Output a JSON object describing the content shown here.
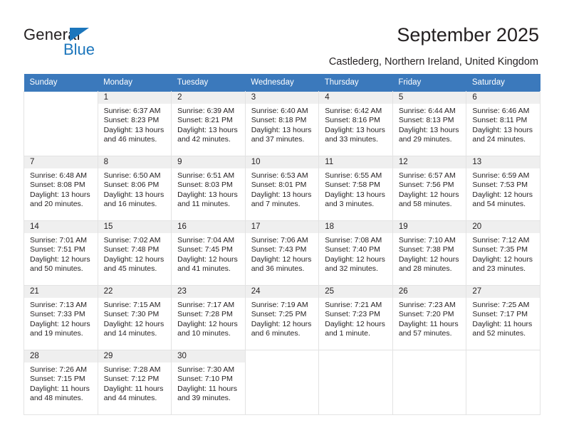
{
  "logo": {
    "word_one": "General",
    "word_two": "Blue",
    "triangle_icon": "blue-triangle-icon",
    "brand_color": "#1c76bc"
  },
  "header": {
    "title": "September 2025",
    "subtitle": "Castlederg, Northern Ireland, United Kingdom"
  },
  "theme": {
    "header_blue": "#3b79bc",
    "daynum_band": "#efefef",
    "grid_border": "#e3e3e3",
    "text": "#231f20"
  },
  "calendar": {
    "weekday_headers": [
      "Sunday",
      "Monday",
      "Tuesday",
      "Wednesday",
      "Thursday",
      "Friday",
      "Saturday"
    ],
    "weeks": [
      [
        {
          "day": "",
          "blank": true,
          "lines": []
        },
        {
          "day": "1",
          "lines": [
            "Sunrise: 6:37 AM",
            "Sunset: 8:23 PM",
            "Daylight: 13 hours",
            "and 46 minutes."
          ]
        },
        {
          "day": "2",
          "lines": [
            "Sunrise: 6:39 AM",
            "Sunset: 8:21 PM",
            "Daylight: 13 hours",
            "and 42 minutes."
          ]
        },
        {
          "day": "3",
          "lines": [
            "Sunrise: 6:40 AM",
            "Sunset: 8:18 PM",
            "Daylight: 13 hours",
            "and 37 minutes."
          ]
        },
        {
          "day": "4",
          "lines": [
            "Sunrise: 6:42 AM",
            "Sunset: 8:16 PM",
            "Daylight: 13 hours",
            "and 33 minutes."
          ]
        },
        {
          "day": "5",
          "lines": [
            "Sunrise: 6:44 AM",
            "Sunset: 8:13 PM",
            "Daylight: 13 hours",
            "and 29 minutes."
          ]
        },
        {
          "day": "6",
          "lines": [
            "Sunrise: 6:46 AM",
            "Sunset: 8:11 PM",
            "Daylight: 13 hours",
            "and 24 minutes."
          ]
        }
      ],
      [
        {
          "day": "7",
          "lines": [
            "Sunrise: 6:48 AM",
            "Sunset: 8:08 PM",
            "Daylight: 13 hours",
            "and 20 minutes."
          ]
        },
        {
          "day": "8",
          "lines": [
            "Sunrise: 6:50 AM",
            "Sunset: 8:06 PM",
            "Daylight: 13 hours",
            "and 16 minutes."
          ]
        },
        {
          "day": "9",
          "lines": [
            "Sunrise: 6:51 AM",
            "Sunset: 8:03 PM",
            "Daylight: 13 hours",
            "and 11 minutes."
          ]
        },
        {
          "day": "10",
          "lines": [
            "Sunrise: 6:53 AM",
            "Sunset: 8:01 PM",
            "Daylight: 13 hours",
            "and 7 minutes."
          ]
        },
        {
          "day": "11",
          "lines": [
            "Sunrise: 6:55 AM",
            "Sunset: 7:58 PM",
            "Daylight: 13 hours",
            "and 3 minutes."
          ]
        },
        {
          "day": "12",
          "lines": [
            "Sunrise: 6:57 AM",
            "Sunset: 7:56 PM",
            "Daylight: 12 hours",
            "and 58 minutes."
          ]
        },
        {
          "day": "13",
          "lines": [
            "Sunrise: 6:59 AM",
            "Sunset: 7:53 PM",
            "Daylight: 12 hours",
            "and 54 minutes."
          ]
        }
      ],
      [
        {
          "day": "14",
          "lines": [
            "Sunrise: 7:01 AM",
            "Sunset: 7:51 PM",
            "Daylight: 12 hours",
            "and 50 minutes."
          ]
        },
        {
          "day": "15",
          "lines": [
            "Sunrise: 7:02 AM",
            "Sunset: 7:48 PM",
            "Daylight: 12 hours",
            "and 45 minutes."
          ]
        },
        {
          "day": "16",
          "lines": [
            "Sunrise: 7:04 AM",
            "Sunset: 7:45 PM",
            "Daylight: 12 hours",
            "and 41 minutes."
          ]
        },
        {
          "day": "17",
          "lines": [
            "Sunrise: 7:06 AM",
            "Sunset: 7:43 PM",
            "Daylight: 12 hours",
            "and 36 minutes."
          ]
        },
        {
          "day": "18",
          "lines": [
            "Sunrise: 7:08 AM",
            "Sunset: 7:40 PM",
            "Daylight: 12 hours",
            "and 32 minutes."
          ]
        },
        {
          "day": "19",
          "lines": [
            "Sunrise: 7:10 AM",
            "Sunset: 7:38 PM",
            "Daylight: 12 hours",
            "and 28 minutes."
          ]
        },
        {
          "day": "20",
          "lines": [
            "Sunrise: 7:12 AM",
            "Sunset: 7:35 PM",
            "Daylight: 12 hours",
            "and 23 minutes."
          ]
        }
      ],
      [
        {
          "day": "21",
          "lines": [
            "Sunrise: 7:13 AM",
            "Sunset: 7:33 PM",
            "Daylight: 12 hours",
            "and 19 minutes."
          ]
        },
        {
          "day": "22",
          "lines": [
            "Sunrise: 7:15 AM",
            "Sunset: 7:30 PM",
            "Daylight: 12 hours",
            "and 14 minutes."
          ]
        },
        {
          "day": "23",
          "lines": [
            "Sunrise: 7:17 AM",
            "Sunset: 7:28 PM",
            "Daylight: 12 hours",
            "and 10 minutes."
          ]
        },
        {
          "day": "24",
          "lines": [
            "Sunrise: 7:19 AM",
            "Sunset: 7:25 PM",
            "Daylight: 12 hours",
            "and 6 minutes."
          ]
        },
        {
          "day": "25",
          "lines": [
            "Sunrise: 7:21 AM",
            "Sunset: 7:23 PM",
            "Daylight: 12 hours",
            "and 1 minute."
          ]
        },
        {
          "day": "26",
          "lines": [
            "Sunrise: 7:23 AM",
            "Sunset: 7:20 PM",
            "Daylight: 11 hours",
            "and 57 minutes."
          ]
        },
        {
          "day": "27",
          "lines": [
            "Sunrise: 7:25 AM",
            "Sunset: 7:17 PM",
            "Daylight: 11 hours",
            "and 52 minutes."
          ]
        }
      ],
      [
        {
          "day": "28",
          "lines": [
            "Sunrise: 7:26 AM",
            "Sunset: 7:15 PM",
            "Daylight: 11 hours",
            "and 48 minutes."
          ]
        },
        {
          "day": "29",
          "lines": [
            "Sunrise: 7:28 AM",
            "Sunset: 7:12 PM",
            "Daylight: 11 hours",
            "and 44 minutes."
          ]
        },
        {
          "day": "30",
          "lines": [
            "Sunrise: 7:30 AM",
            "Sunset: 7:10 PM",
            "Daylight: 11 hours",
            "and 39 minutes."
          ]
        },
        {
          "day": "",
          "blank": true,
          "lines": []
        },
        {
          "day": "",
          "blank": true,
          "lines": []
        },
        {
          "day": "",
          "blank": true,
          "lines": []
        },
        {
          "day": "",
          "blank": true,
          "lines": []
        }
      ]
    ]
  }
}
